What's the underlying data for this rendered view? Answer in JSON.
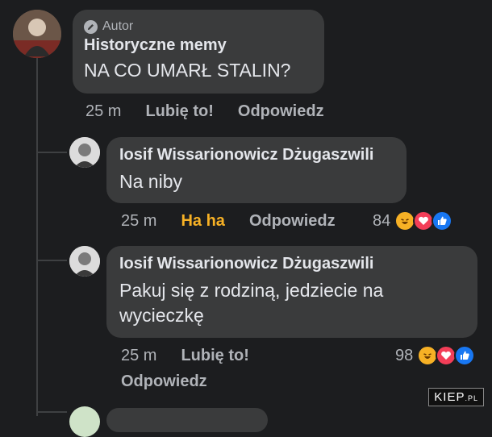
{
  "post": {
    "author_badge": "Autor",
    "author": "Historyczne memy",
    "text": "NA CO UMARŁ STALIN?",
    "time": "25 m",
    "like_label": "Lubię to!",
    "reply_label": "Odpowiedz"
  },
  "replies": [
    {
      "author": "Iosif Wissarionowicz Dżugaszwili",
      "text": "Na niby",
      "time": "25 m",
      "reaction_label": "Ha ha",
      "reply_label": "Odpowiedz",
      "reaction_count": "84"
    },
    {
      "author": "Iosif Wissarionowicz Dżugaszwili",
      "text_line1": "Pakuj się z rodziną, jedziecie na",
      "text_line2": "wycieczkę",
      "time": "25 m",
      "like_label": "Lubię to!",
      "reply_label": "Odpowiedz",
      "reaction_count": "98"
    }
  ],
  "watermark": {
    "main": "KIEP",
    "suffix": ".PL"
  },
  "colors": {
    "background": "#1c1d1f",
    "bubble": "#3a3b3c",
    "haha": "#f7b125",
    "love": "#f33e58",
    "like": "#1877f2"
  },
  "icons": [
    "pencil-icon",
    "haha-reaction-icon",
    "love-reaction-icon",
    "like-reaction-icon"
  ]
}
